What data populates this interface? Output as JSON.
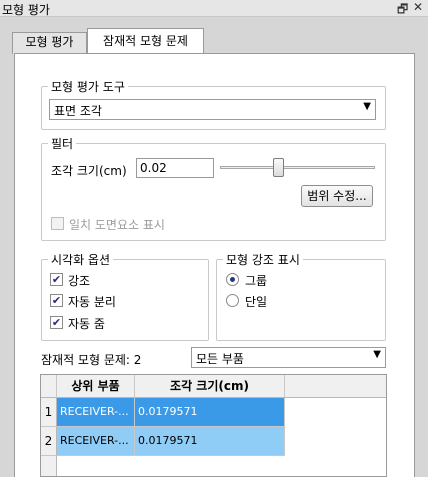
{
  "window": {
    "title": "모형 평가",
    "icons": [
      "restore-icon",
      "close-icon"
    ]
  },
  "tabs": [
    {
      "label": "모형 평가",
      "active": false
    },
    {
      "label": "잠재적 모형 문제",
      "active": true
    }
  ],
  "tool_group": {
    "legend": "모형 평가 도구",
    "selected": "표면 조각"
  },
  "filter_group": {
    "legend": "필터",
    "size_label": "조각 크기(cm)",
    "size_value": "0.02",
    "slider_position": 0.37,
    "range_button": "범위 수정...",
    "show_checkbox_label": "일치 도면요소 표시",
    "show_checked": false
  },
  "visual_group": {
    "legend": "시각화 옵션",
    "options": [
      {
        "label": "강조",
        "checked": true
      },
      {
        "label": "자동 분리",
        "checked": true
      },
      {
        "label": "자동 줌",
        "checked": true
      }
    ]
  },
  "highlight_group": {
    "legend": "모형 강조 표시",
    "options": [
      {
        "label": "그룹",
        "selected": true
      },
      {
        "label": "단일",
        "selected": false
      }
    ]
  },
  "issues": {
    "count_label": "잠재적 모형 문제: 2",
    "filter_selected": "모든 부품"
  },
  "table": {
    "columns": [
      "상위 부품",
      "조각 크기(cm)"
    ],
    "rows": [
      {
        "index": "1",
        "part": "RECEIVER-...",
        "size": "0.0179571",
        "selected": true
      },
      {
        "index": "2",
        "part": "RECEIVER-...",
        "size": "0.0179571",
        "selected": true
      }
    ]
  }
}
